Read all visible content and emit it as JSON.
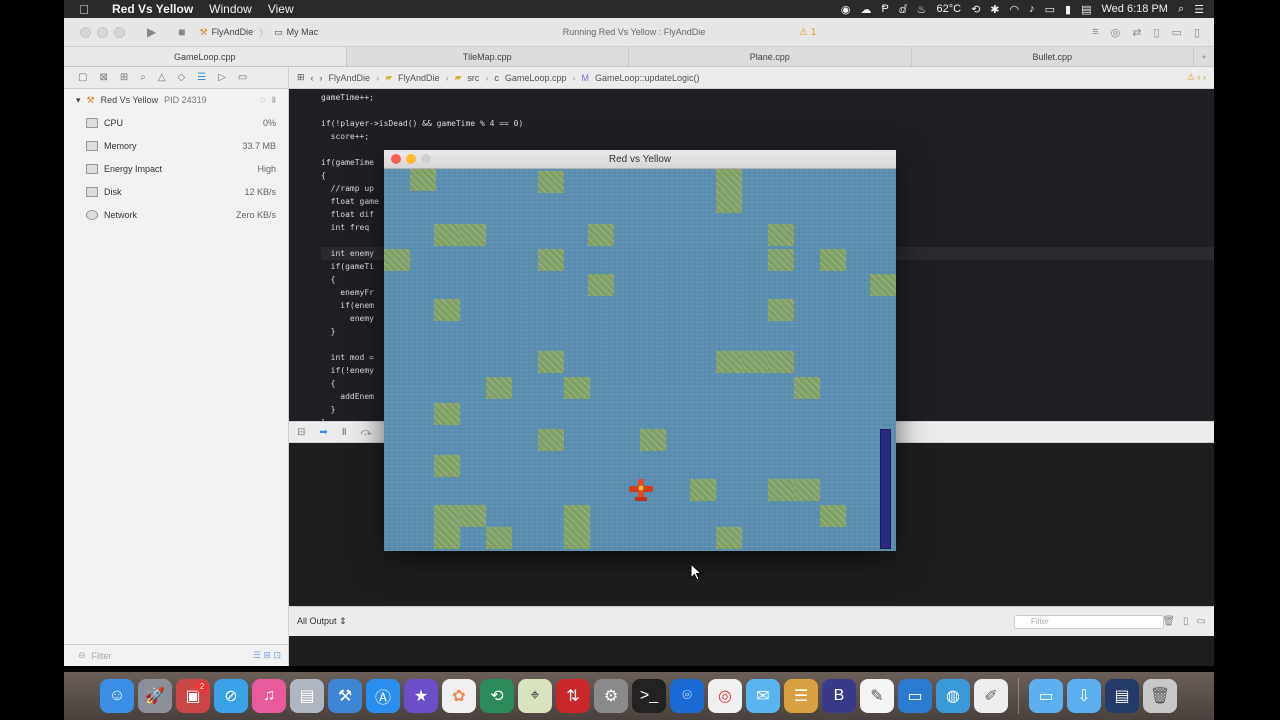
{
  "menubar": {
    "app_name": "Red Vs Yellow",
    "menu_window": "Window",
    "menu_view": "View",
    "temperature": "62°C",
    "clock": "Wed 6:18 PM"
  },
  "toolbar": {
    "scheme_target": "FlyAndDie",
    "scheme_device": "My Mac",
    "activity_text": "Running Red Vs Yellow : FlyAndDie",
    "warning_count": "1"
  },
  "tabs": [
    "GameLoop.cpp",
    "TileMap.cpp",
    "Plane.cpp",
    "Bullet.cpp"
  ],
  "jumpbar": {
    "project": "FlyAndDie",
    "group": "FlyAndDie",
    "folder": "src",
    "file": "GameLoop.cpp",
    "symbol": "GameLoop::updateLogic()"
  },
  "debug_navigator": {
    "process_name": "Red Vs Yellow",
    "process_pid": "PID 24319",
    "gauges": [
      {
        "label": "CPU",
        "value": "0%"
      },
      {
        "label": "Memory",
        "value": "33.7 MB"
      },
      {
        "label": "Energy Impact",
        "value": "High"
      },
      {
        "label": "Disk",
        "value": "12 KB/s"
      },
      {
        "label": "Network",
        "value": "Zero KB/s"
      }
    ],
    "filter_placeholder": "Filter"
  },
  "code_lines": [
    "gameTime++;",
    "",
    "if(!player->isDead() && gameTime % 4 == 0)",
    "  score++;",
    "",
    "if(gameTime",
    "{",
    "  //ramp up",
    "  float game",
    "  float dif",
    "  int freq ",
    "",
    "  int enemy",
    "  if(gameTi",
    "  {",
    "    enemyFr",
    "    if(enem",
    "      enemy",
    "  }",
    "",
    "  int mod =",
    "  if(!enemy",
    "  {",
    "    addEnem",
    "  }",
    "}"
  ],
  "console": {
    "output_selector": "All Output ⇕",
    "filter_placeholder": "Filter"
  },
  "game_window": {
    "title": "Red vs Yellow"
  }
}
